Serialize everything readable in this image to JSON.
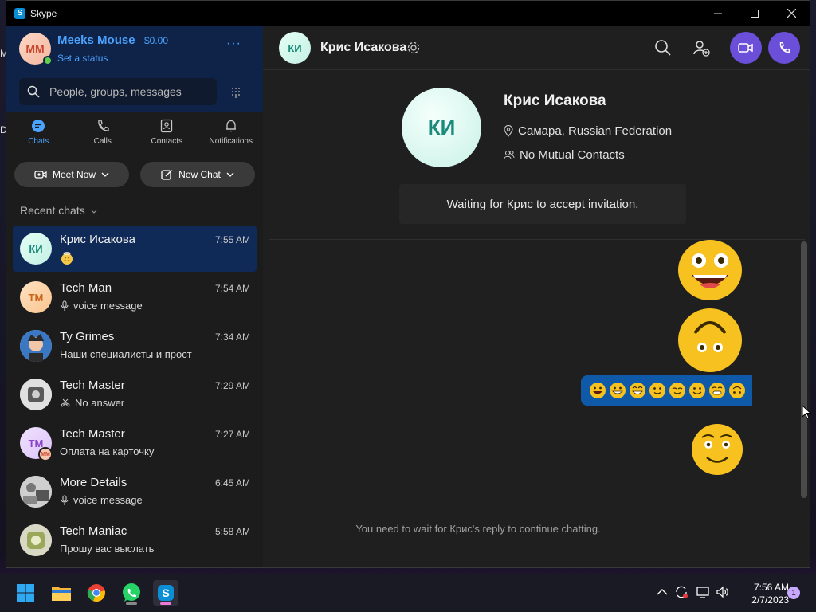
{
  "window": {
    "title": "Skype",
    "min_icon": "minimize-icon",
    "max_icon": "maximize-icon",
    "close_icon": "close-icon"
  },
  "desktop_edge": [
    "M",
    "D"
  ],
  "me": {
    "initials": "MM",
    "name": "Meeks Mouse",
    "credit": "$0.00",
    "status": "Set a status",
    "more": "···"
  },
  "search": {
    "placeholder": "People, groups, messages"
  },
  "nav": [
    {
      "label": "Chats",
      "icon": "chat-icon"
    },
    {
      "label": "Calls",
      "icon": "phone-icon"
    },
    {
      "label": "Contacts",
      "icon": "contacts-icon"
    },
    {
      "label": "Notifications",
      "icon": "bell-icon"
    }
  ],
  "actions": {
    "meet_now": "Meet Now",
    "new_chat": "New Chat"
  },
  "recent": {
    "header": "Recent chats"
  },
  "chats": [
    {
      "name": "Крис Исакова",
      "initials": "КИ",
      "time": "7:55 AM",
      "preview": "",
      "preview_icon": "emoji-icon"
    },
    {
      "name": "Tech Man",
      "initials": "TM",
      "time": "7:54 AM",
      "preview": "voice message",
      "preview_icon": "mic-icon"
    },
    {
      "name": "Ty Grimes",
      "initials": "",
      "time": "7:34 AM",
      "preview": "Наши специалисты и прост",
      "preview_icon": ""
    },
    {
      "name": "Tech Master",
      "initials": "",
      "time": "7:29 AM",
      "preview": "No answer",
      "preview_icon": "missed-call-icon"
    },
    {
      "name": "Tech Master",
      "initials": "TM",
      "time": "7:27 AM",
      "preview": "Оплата на карточку",
      "preview_icon": ""
    },
    {
      "name": "More Details",
      "initials": "",
      "time": "6:45 AM",
      "preview": "voice message",
      "preview_icon": "mic-icon"
    },
    {
      "name": "Tech Maniac",
      "initials": "",
      "time": "5:58 AM",
      "preview": "Прошу вас выслать",
      "preview_icon": ""
    }
  ],
  "conversation": {
    "initials": "КИ",
    "name": "Крис Исакова",
    "location": "Самара, Russian Federation",
    "mutual": "No Mutual Contacts",
    "waiting": "Waiting for Крис to accept invitation.",
    "footer": "You need to wait for Крис's reply to continue chatting."
  },
  "taskbar": {
    "time": "7:56 AM",
    "date": "2/7/2023",
    "badge": "1",
    "apps": [
      "windows-start-icon",
      "file-explorer-icon",
      "chrome-icon",
      "whatsapp-icon",
      "skype-icon"
    ]
  },
  "colors": {
    "accent": "#4aa3ff",
    "call_button": "#6b4fd8",
    "selected_chat": "#102a57",
    "emoji_strip": "#0f5aa8"
  }
}
